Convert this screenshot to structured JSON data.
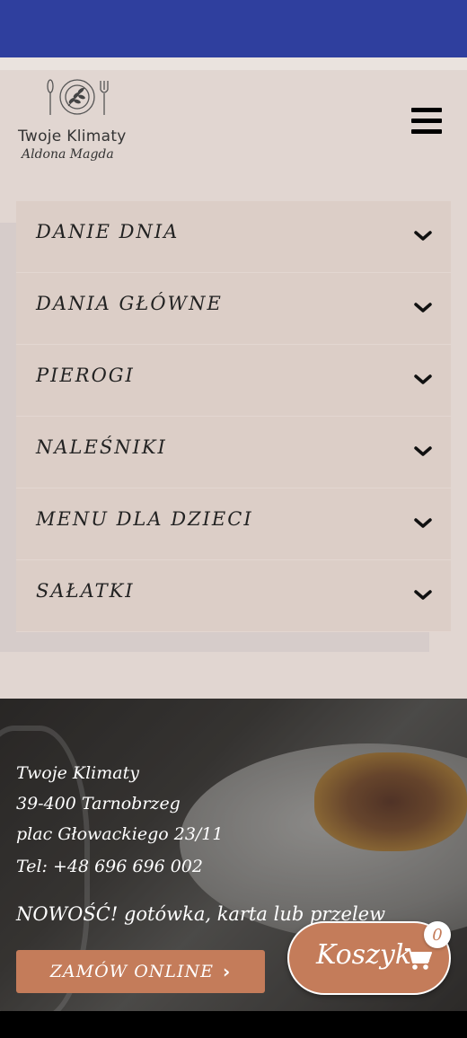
{
  "brand": {
    "line1": "Twoje Klimaty",
    "line2": "Aldona Magda"
  },
  "menu": {
    "items": [
      {
        "label": "DANIE DNIA"
      },
      {
        "label": "DANIA GŁÓWNE"
      },
      {
        "label": "PIEROGI"
      },
      {
        "label": "NALEŚNIKI"
      },
      {
        "label": "MENU DLA DZIECI"
      },
      {
        "label": "SAŁATKI"
      }
    ]
  },
  "footer": {
    "name": "Twoje Klimaty",
    "city": "39-400 Tarnobrzeg",
    "street": "plac Głowackiego 23/11",
    "phone": "Tel: +48 696 696 002",
    "promo": "NOWOŚĆ! gotówka, karta lub przelew",
    "order_label": "ZAMÓW ONLINE"
  },
  "cart": {
    "label": "Koszyk",
    "count": "0"
  },
  "colors": {
    "status_bar": "#2f3f9e",
    "accent": "#c47c5a",
    "menu_bg": "#dccec7",
    "page_bg": "#e1d6d1"
  },
  "icons": {
    "hamburger": "hamburger-icon",
    "chevron": "chevron-down-icon",
    "cart": "shopping-cart-icon",
    "arrow": "chevron-right-icon"
  }
}
